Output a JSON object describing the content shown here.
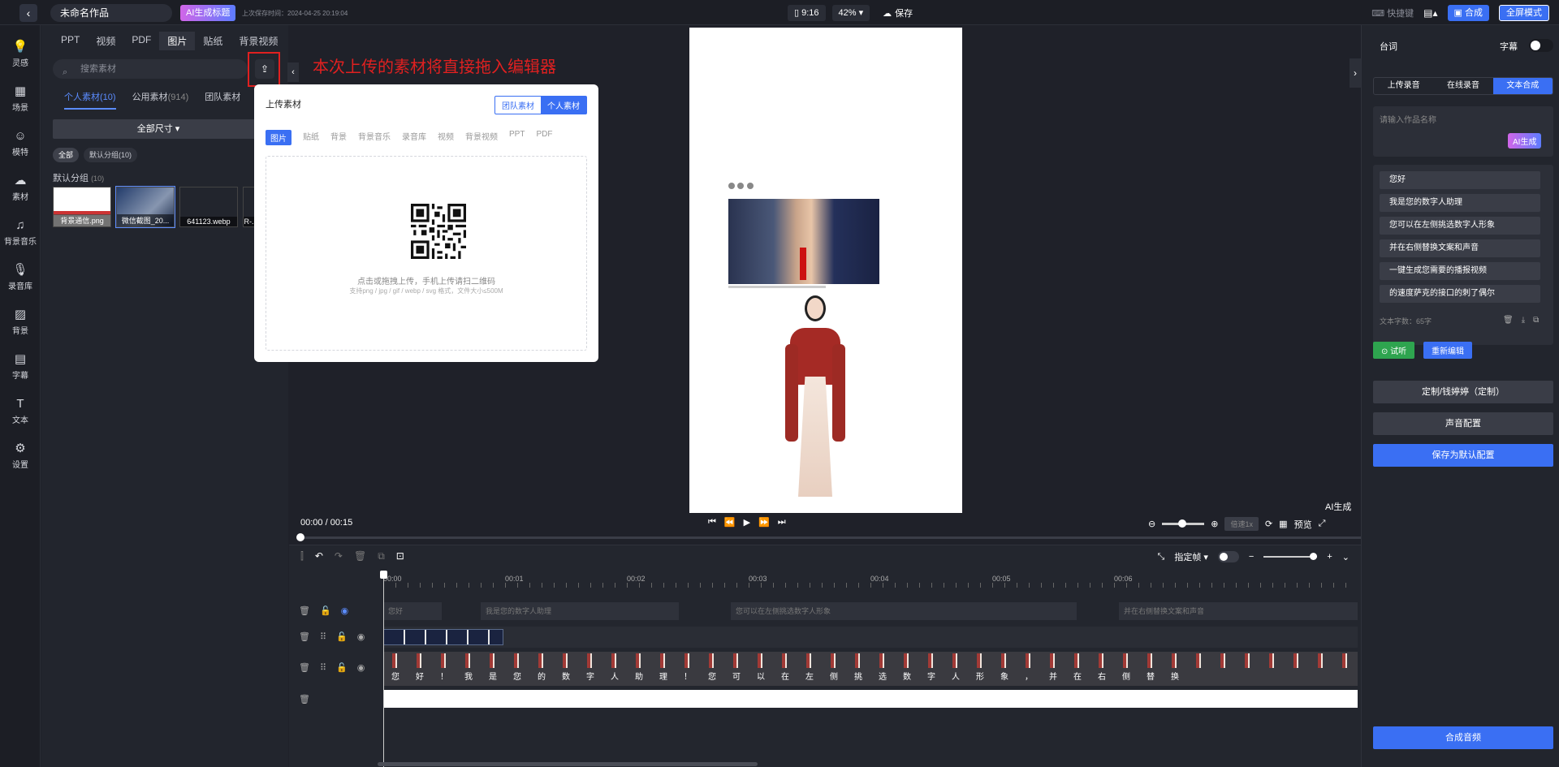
{
  "topbar": {
    "back_icon": "chevron-left-icon",
    "project_title": "未命名作品",
    "ai_title_btn": "AI生成标题",
    "save_time": "上次保存时间：2024-04-25 20:19:04",
    "ratio": "9:16",
    "zoom": "42%",
    "save": "保存",
    "shortcut": "快捷键",
    "compose": "合成",
    "fullscreen": "全屏模式"
  },
  "rail": [
    {
      "icon": "bulb-icon",
      "label": "灵感"
    },
    {
      "icon": "scene-icon",
      "label": "场景"
    },
    {
      "icon": "model-icon",
      "label": "模特"
    },
    {
      "icon": "cloud-icon",
      "label": "素材"
    },
    {
      "icon": "music-icon",
      "label": "背景音乐"
    },
    {
      "icon": "mic-icon",
      "label": "录音库"
    },
    {
      "icon": "background-icon",
      "label": "背景"
    },
    {
      "icon": "subtitle-icon",
      "label": "字幕"
    },
    {
      "icon": "text-icon",
      "label": "文本"
    },
    {
      "icon": "settings-icon",
      "label": "设置"
    }
  ],
  "side": {
    "tabs": [
      "PPT",
      "视频",
      "PDF",
      "图片",
      "贴纸",
      "背景视频"
    ],
    "search_placeholder": "搜索素材",
    "subtabs": [
      {
        "label": "个人素材",
        "count": "(10)"
      },
      {
        "label": "公用素材",
        "count": "(914)"
      },
      {
        "label": "团队素材",
        "count": ""
      }
    ],
    "size_filter": "全部尺寸",
    "chips": [
      "全部",
      "默认分组(10)"
    ],
    "group_label": "默认分组",
    "group_count": "(10)",
    "thumbs": [
      "背景通信.png",
      "微信截图_20...",
      "641123.webp",
      "R-..."
    ]
  },
  "annotation": "本次上传的素材将直接拖入编辑器",
  "popup": {
    "title": "上传素材",
    "seg": [
      "团队素材",
      "个人素材"
    ],
    "tabs": [
      "图片",
      "贴纸",
      "背景",
      "背景音乐",
      "录音库",
      "视频",
      "背景视频",
      "PPT",
      "PDF"
    ],
    "hint1": "点击或拖拽上传，手机上传请扫二维码",
    "hint2": "支持png / jpg / gif / webp / svg 格式，文件大小≤500M"
  },
  "player": {
    "time": "00:00 / 00:15",
    "ai_gen": "AI生成",
    "speed": "倍速1x",
    "preview": "预览"
  },
  "timeline": {
    "frame_label": "指定帧",
    "ruler": [
      "00:00",
      "00:01",
      "00:02",
      "00:03",
      "00:04",
      "00:05",
      "00:06"
    ],
    "subs": [
      "您好",
      "我是您的数字人助理",
      "您可以在左侧挑选数字人形象",
      "并在右侧替换文案和声音"
    ],
    "chars": [
      "您",
      "好",
      "！",
      "我",
      "是",
      "您",
      "的",
      "数",
      "字",
      "人",
      "助",
      "理",
      "！",
      "您",
      "可",
      "以",
      "在",
      "左",
      "侧",
      "挑",
      "选",
      "数",
      "字",
      "人",
      "形",
      "象",
      "，",
      "并",
      "在",
      "右",
      "侧",
      "替",
      "换"
    ]
  },
  "right": {
    "header": "台词",
    "subtitle_toggle": "字幕",
    "tabs": [
      "上传录音",
      "在线录音",
      "文本合成"
    ],
    "name_placeholder": "请输入作品名称",
    "ai_btn": "AI生成",
    "lines": [
      "您好",
      "我是您的数字人助理",
      "您可以在左侧挑选数字人形象",
      "并在右侧替换文案和声音",
      "一键生成您需要的播报视频",
      "的速度萨克的接口的刺了偶尔"
    ],
    "count": "文本字数：65字",
    "try": "试听",
    "reedit": "重新编辑",
    "voice_custom": "定制/钱婷婷（定制）",
    "voice_config": "声音配置",
    "save_default": "保存为默认配置",
    "compose_audio": "合成音频"
  }
}
